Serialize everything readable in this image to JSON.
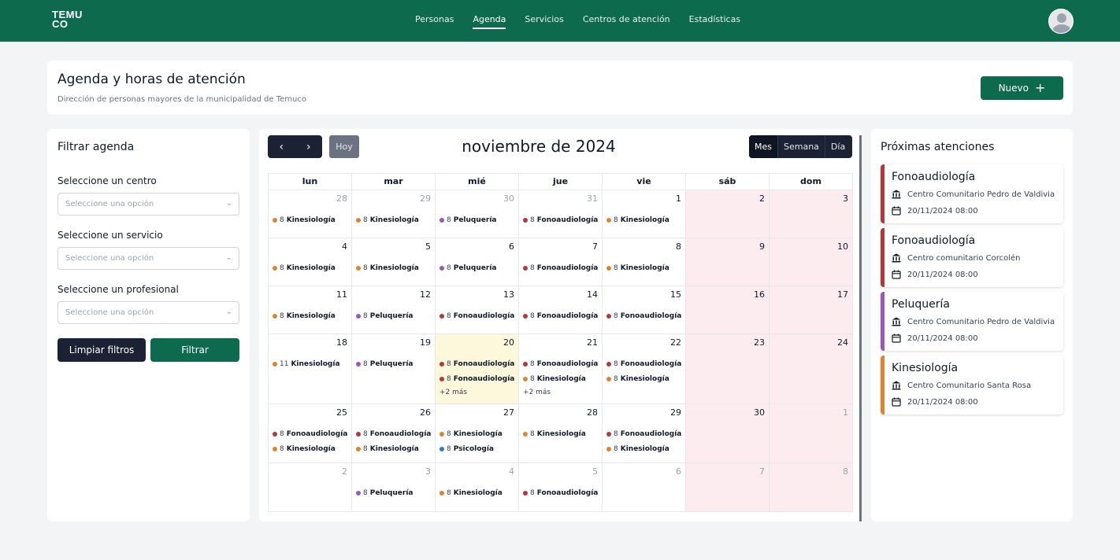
{
  "nav": {
    "logo_line1": "TEMU",
    "logo_line2": "CO",
    "links": [
      "Personas",
      "Agenda",
      "Servicios",
      "Centros de atención",
      "Estadísticas"
    ],
    "active": "Agenda"
  },
  "header": {
    "title": "Agenda y horas de atención",
    "subtitle": "Dirección de personas mayores de la municipalidad de Temuco",
    "new_label": "Nuevo"
  },
  "filters": {
    "title": "Filtrar agenda",
    "center_label": "Seleccione un centro",
    "service_label": "Seleccione un servicio",
    "professional_label": "Seleccione un profesional",
    "placeholder": "Seleccione una opción",
    "clear_label": "Limpiar filtros",
    "filter_label": "Filtrar"
  },
  "calendar": {
    "title": "noviembre de 2024",
    "today_label": "Hoy",
    "views": [
      "Mes",
      "Semana",
      "Día"
    ],
    "active_view": "Mes",
    "weekdays": [
      "lun",
      "mar",
      "mié",
      "jue",
      "vie",
      "sáb",
      "dom"
    ],
    "colors": {
      "Kinesiología": "#d9862f",
      "Peluquería": "#9b59b6",
      "Fonoaudiología": "#b03a3a",
      "Psicología": "#2f7ec2"
    },
    "weeks": [
      [
        {
          "n": "28",
          "other": true,
          "events": [
            [
              "8",
              "Kinesiología"
            ]
          ]
        },
        {
          "n": "29",
          "other": true,
          "events": [
            [
              "8",
              "Kinesiología"
            ]
          ]
        },
        {
          "n": "30",
          "other": true,
          "events": [
            [
              "8",
              "Peluquería"
            ]
          ]
        },
        {
          "n": "31",
          "other": true,
          "events": [
            [
              "8",
              "Fonoaudiología"
            ]
          ]
        },
        {
          "n": "1",
          "events": [
            [
              "8",
              "Kinesiología"
            ]
          ]
        },
        {
          "n": "2",
          "weekend": true,
          "events": []
        },
        {
          "n": "3",
          "weekend": true,
          "events": []
        }
      ],
      [
        {
          "n": "4",
          "events": [
            [
              "8",
              "Kinesiología"
            ]
          ]
        },
        {
          "n": "5",
          "events": [
            [
              "8",
              "Kinesiología"
            ]
          ]
        },
        {
          "n": "6",
          "events": [
            [
              "8",
              "Peluquería"
            ]
          ]
        },
        {
          "n": "7",
          "events": [
            [
              "8",
              "Fonoaudiología"
            ]
          ]
        },
        {
          "n": "8",
          "events": [
            [
              "8",
              "Kinesiología"
            ]
          ]
        },
        {
          "n": "9",
          "weekend": true,
          "events": []
        },
        {
          "n": "10",
          "weekend": true,
          "events": []
        }
      ],
      [
        {
          "n": "11",
          "events": [
            [
              "8",
              "Kinesiología"
            ]
          ]
        },
        {
          "n": "12",
          "events": [
            [
              "8",
              "Peluquería"
            ]
          ]
        },
        {
          "n": "13",
          "events": [
            [
              "8",
              "Fonoaudiología"
            ]
          ]
        },
        {
          "n": "14",
          "events": [
            [
              "8",
              "Fonoaudiología"
            ]
          ]
        },
        {
          "n": "15",
          "events": [
            [
              "8",
              "Fonoaudiología"
            ]
          ]
        },
        {
          "n": "16",
          "weekend": true,
          "events": []
        },
        {
          "n": "17",
          "weekend": true,
          "events": []
        }
      ],
      [
        {
          "n": "18",
          "events": [
            [
              "11",
              "Kinesiología"
            ]
          ]
        },
        {
          "n": "19",
          "events": [
            [
              "8",
              "Peluquería"
            ]
          ]
        },
        {
          "n": "20",
          "today": true,
          "events": [
            [
              "8",
              "Fonoaudiología"
            ],
            [
              "8",
              "Fonoaudiología"
            ]
          ],
          "more": "+2 más"
        },
        {
          "n": "21",
          "events": [
            [
              "8",
              "Fonoaudiología"
            ],
            [
              "8",
              "Kinesiología"
            ]
          ],
          "more": "+2 más"
        },
        {
          "n": "22",
          "events": [
            [
              "8",
              "Fonoaudiología"
            ],
            [
              "8",
              "Kinesiología"
            ]
          ]
        },
        {
          "n": "23",
          "weekend": true,
          "events": []
        },
        {
          "n": "24",
          "weekend": true,
          "events": []
        }
      ],
      [
        {
          "n": "25",
          "events": [
            [
              "8",
              "Fonoaudiología"
            ],
            [
              "8",
              "Kinesiología"
            ]
          ]
        },
        {
          "n": "26",
          "events": [
            [
              "8",
              "Fonoaudiología"
            ],
            [
              "8",
              "Kinesiología"
            ]
          ]
        },
        {
          "n": "27",
          "events": [
            [
              "8",
              "Kinesiología"
            ],
            [
              "8",
              "Psicología"
            ]
          ]
        },
        {
          "n": "28",
          "events": [
            [
              "8",
              "Kinesiología"
            ]
          ]
        },
        {
          "n": "29",
          "events": [
            [
              "8",
              "Fonoaudiología"
            ],
            [
              "8",
              "Kinesiología"
            ]
          ]
        },
        {
          "n": "30",
          "weekend": true,
          "events": []
        },
        {
          "n": "1",
          "weekend": true,
          "other": true,
          "events": []
        }
      ],
      [
        {
          "n": "2",
          "other": true,
          "events": []
        },
        {
          "n": "3",
          "other": true,
          "events": [
            [
              "8",
              "Peluquería"
            ]
          ]
        },
        {
          "n": "4",
          "other": true,
          "events": [
            [
              "8",
              "Kinesiología"
            ]
          ]
        },
        {
          "n": "5",
          "other": true,
          "events": [
            [
              "8",
              "Fonoaudiología"
            ]
          ]
        },
        {
          "n": "6",
          "other": true,
          "events": []
        },
        {
          "n": "7",
          "other": true,
          "weekend": true,
          "events": []
        },
        {
          "n": "8",
          "other": true,
          "weekend": true,
          "events": []
        }
      ]
    ]
  },
  "upcoming": {
    "title": "Próximas atenciones",
    "items": [
      {
        "service": "Fonoaudiología",
        "center": "Centro Comunitario Pedro de Valdivia",
        "datetime": "20/11/2024 08:00",
        "color": "#b03a3a"
      },
      {
        "service": "Fonoaudiología",
        "center": "Centro comunitario Corcolén",
        "datetime": "20/11/2024 08:00",
        "color": "#b03a3a"
      },
      {
        "service": "Peluquería",
        "center": "Centro Comunitario Pedro de Valdivia",
        "datetime": "20/11/2024 08:00",
        "color": "#9b59b6"
      },
      {
        "service": "Kinesiología",
        "center": "Centro Comunitario Santa Rosa",
        "datetime": "20/11/2024 08:00",
        "color": "#d9862f"
      }
    ]
  }
}
